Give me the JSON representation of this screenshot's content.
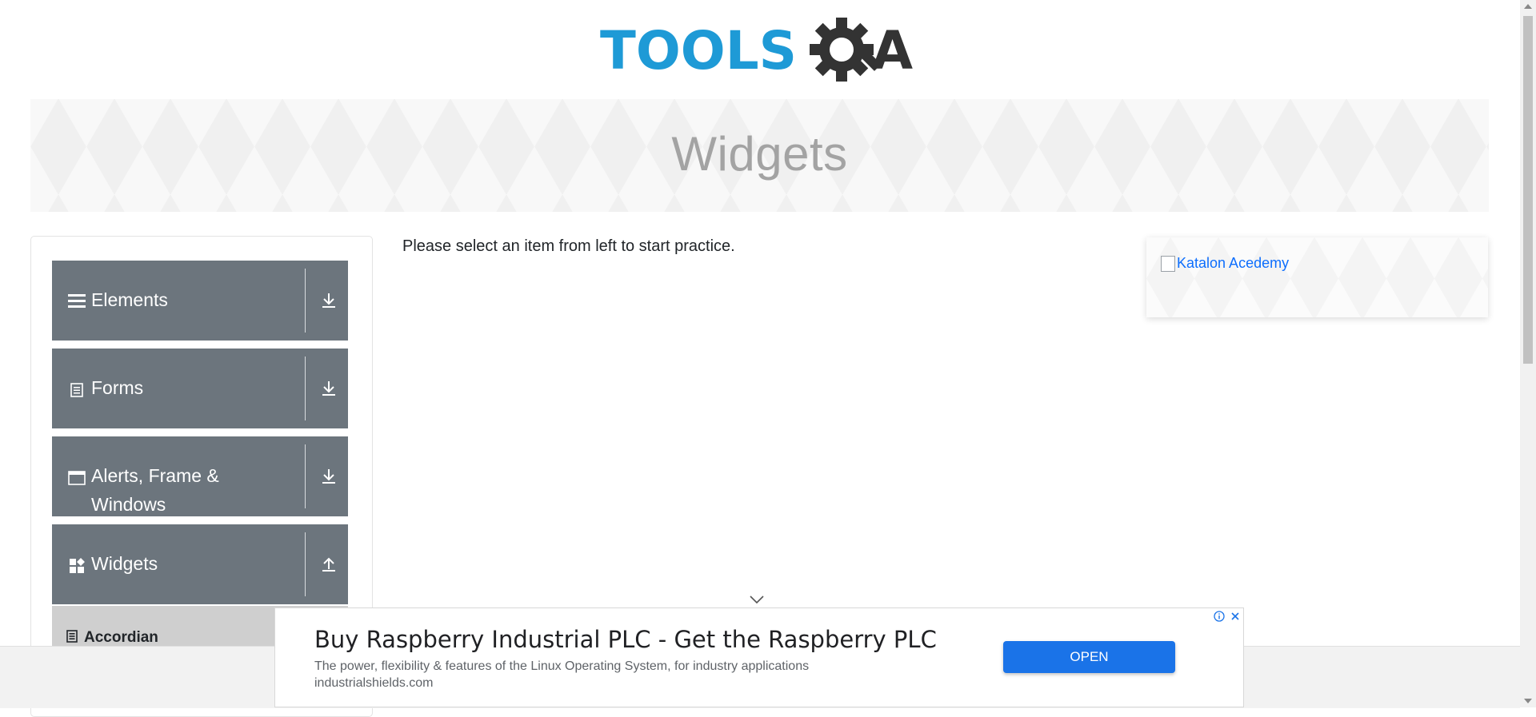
{
  "logo": {
    "alt": "TOOLSQA",
    "text_left": "TOOLS",
    "text_right": "A",
    "color_blue": "#1e9ad6",
    "color_dark": "#333333"
  },
  "banner": {
    "title": "Widgets"
  },
  "sidebar": {
    "groups": [
      {
        "label": "Elements",
        "icon": "hamburger-icon",
        "toggle_icon": "download-arrow-icon"
      },
      {
        "label": "Forms",
        "icon": "document-icon",
        "toggle_icon": "download-arrow-icon"
      },
      {
        "label": "Alerts, Frame & Windows",
        "icon": "window-icon",
        "toggle_icon": "download-arrow-icon"
      },
      {
        "label": "Widgets",
        "icon": "widgets-icon",
        "toggle_icon": "upload-arrow-icon"
      }
    ],
    "submenu": [
      {
        "label": "Accordian",
        "icon": "accordian-icon"
      }
    ]
  },
  "main": {
    "message": "Please select an item from left to start practice."
  },
  "ad_card": {
    "link_text": "Katalon Acedemy"
  },
  "bottom_ad": {
    "title": "Buy Raspberry Industrial PLC - Get the Raspberry PLC",
    "description": "The power, flexibility & features of the Linux Operating System, for industry applications",
    "domain": "industrialshields.com",
    "button_label": "OPEN",
    "info_icon": "info-icon",
    "close_icon": "close-icon"
  },
  "colors": {
    "group_bg": "#6c757d",
    "submenu_bg": "#cfcfcf",
    "ad_button": "#1a73e8",
    "link": "#0d6efd"
  }
}
